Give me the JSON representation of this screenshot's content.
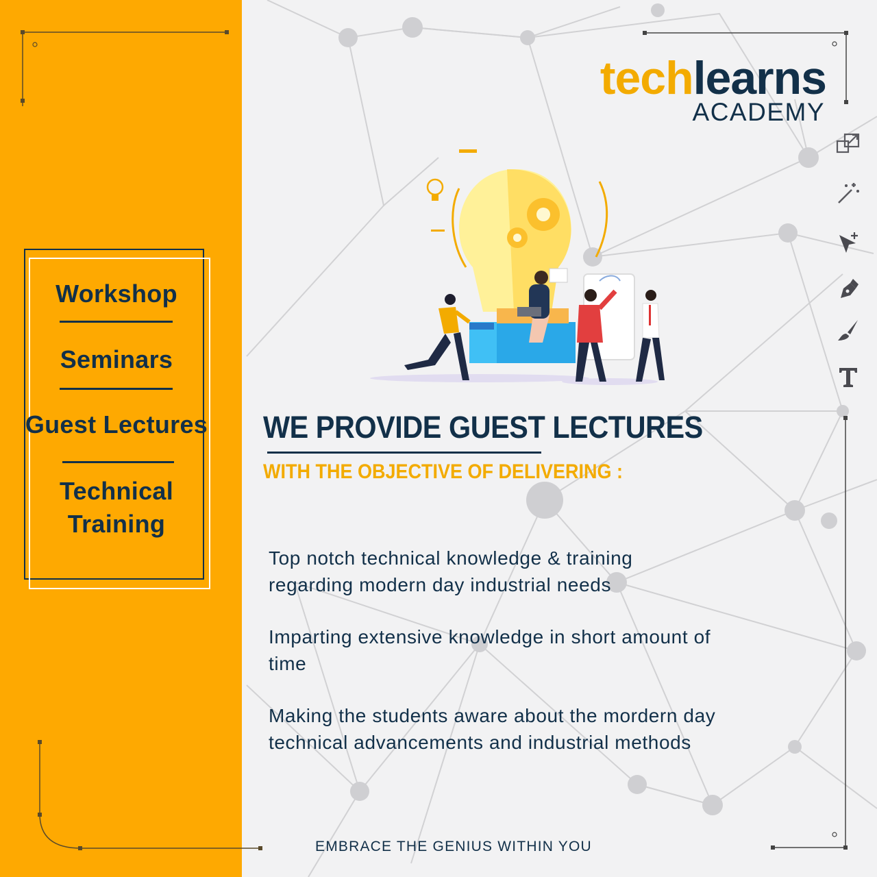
{
  "brand": {
    "name_part1": "tech",
    "name_part2": "learns",
    "subtitle": "ACADEMY",
    "accent_color": "#fea901",
    "dark_color": "#123049"
  },
  "menu": {
    "items": [
      "Workshop",
      "Seminars",
      "Guest Lectures",
      "Technical\nTraining"
    ]
  },
  "main": {
    "headline": "WE PROVIDE GUEST LECTURES",
    "subheadline": "WITH THE OBJECTIVE OF DELIVERING :",
    "points": [
      "Top notch technical knowledge & training\nregarding modern day industrial needs",
      "Imparting extensive knowledge in short amount of\ntime",
      "Making the students aware about the mordern day\ntechnical advancements and industrial methods"
    ]
  },
  "footer": {
    "tagline": "EMBRACE THE GENIUS WITHIN YOU"
  },
  "toolbar": {
    "icons": [
      "transform-icon",
      "magic-wand-icon",
      "select-add-icon",
      "pen-tool-icon",
      "brush-icon",
      "text-tool-icon"
    ]
  }
}
